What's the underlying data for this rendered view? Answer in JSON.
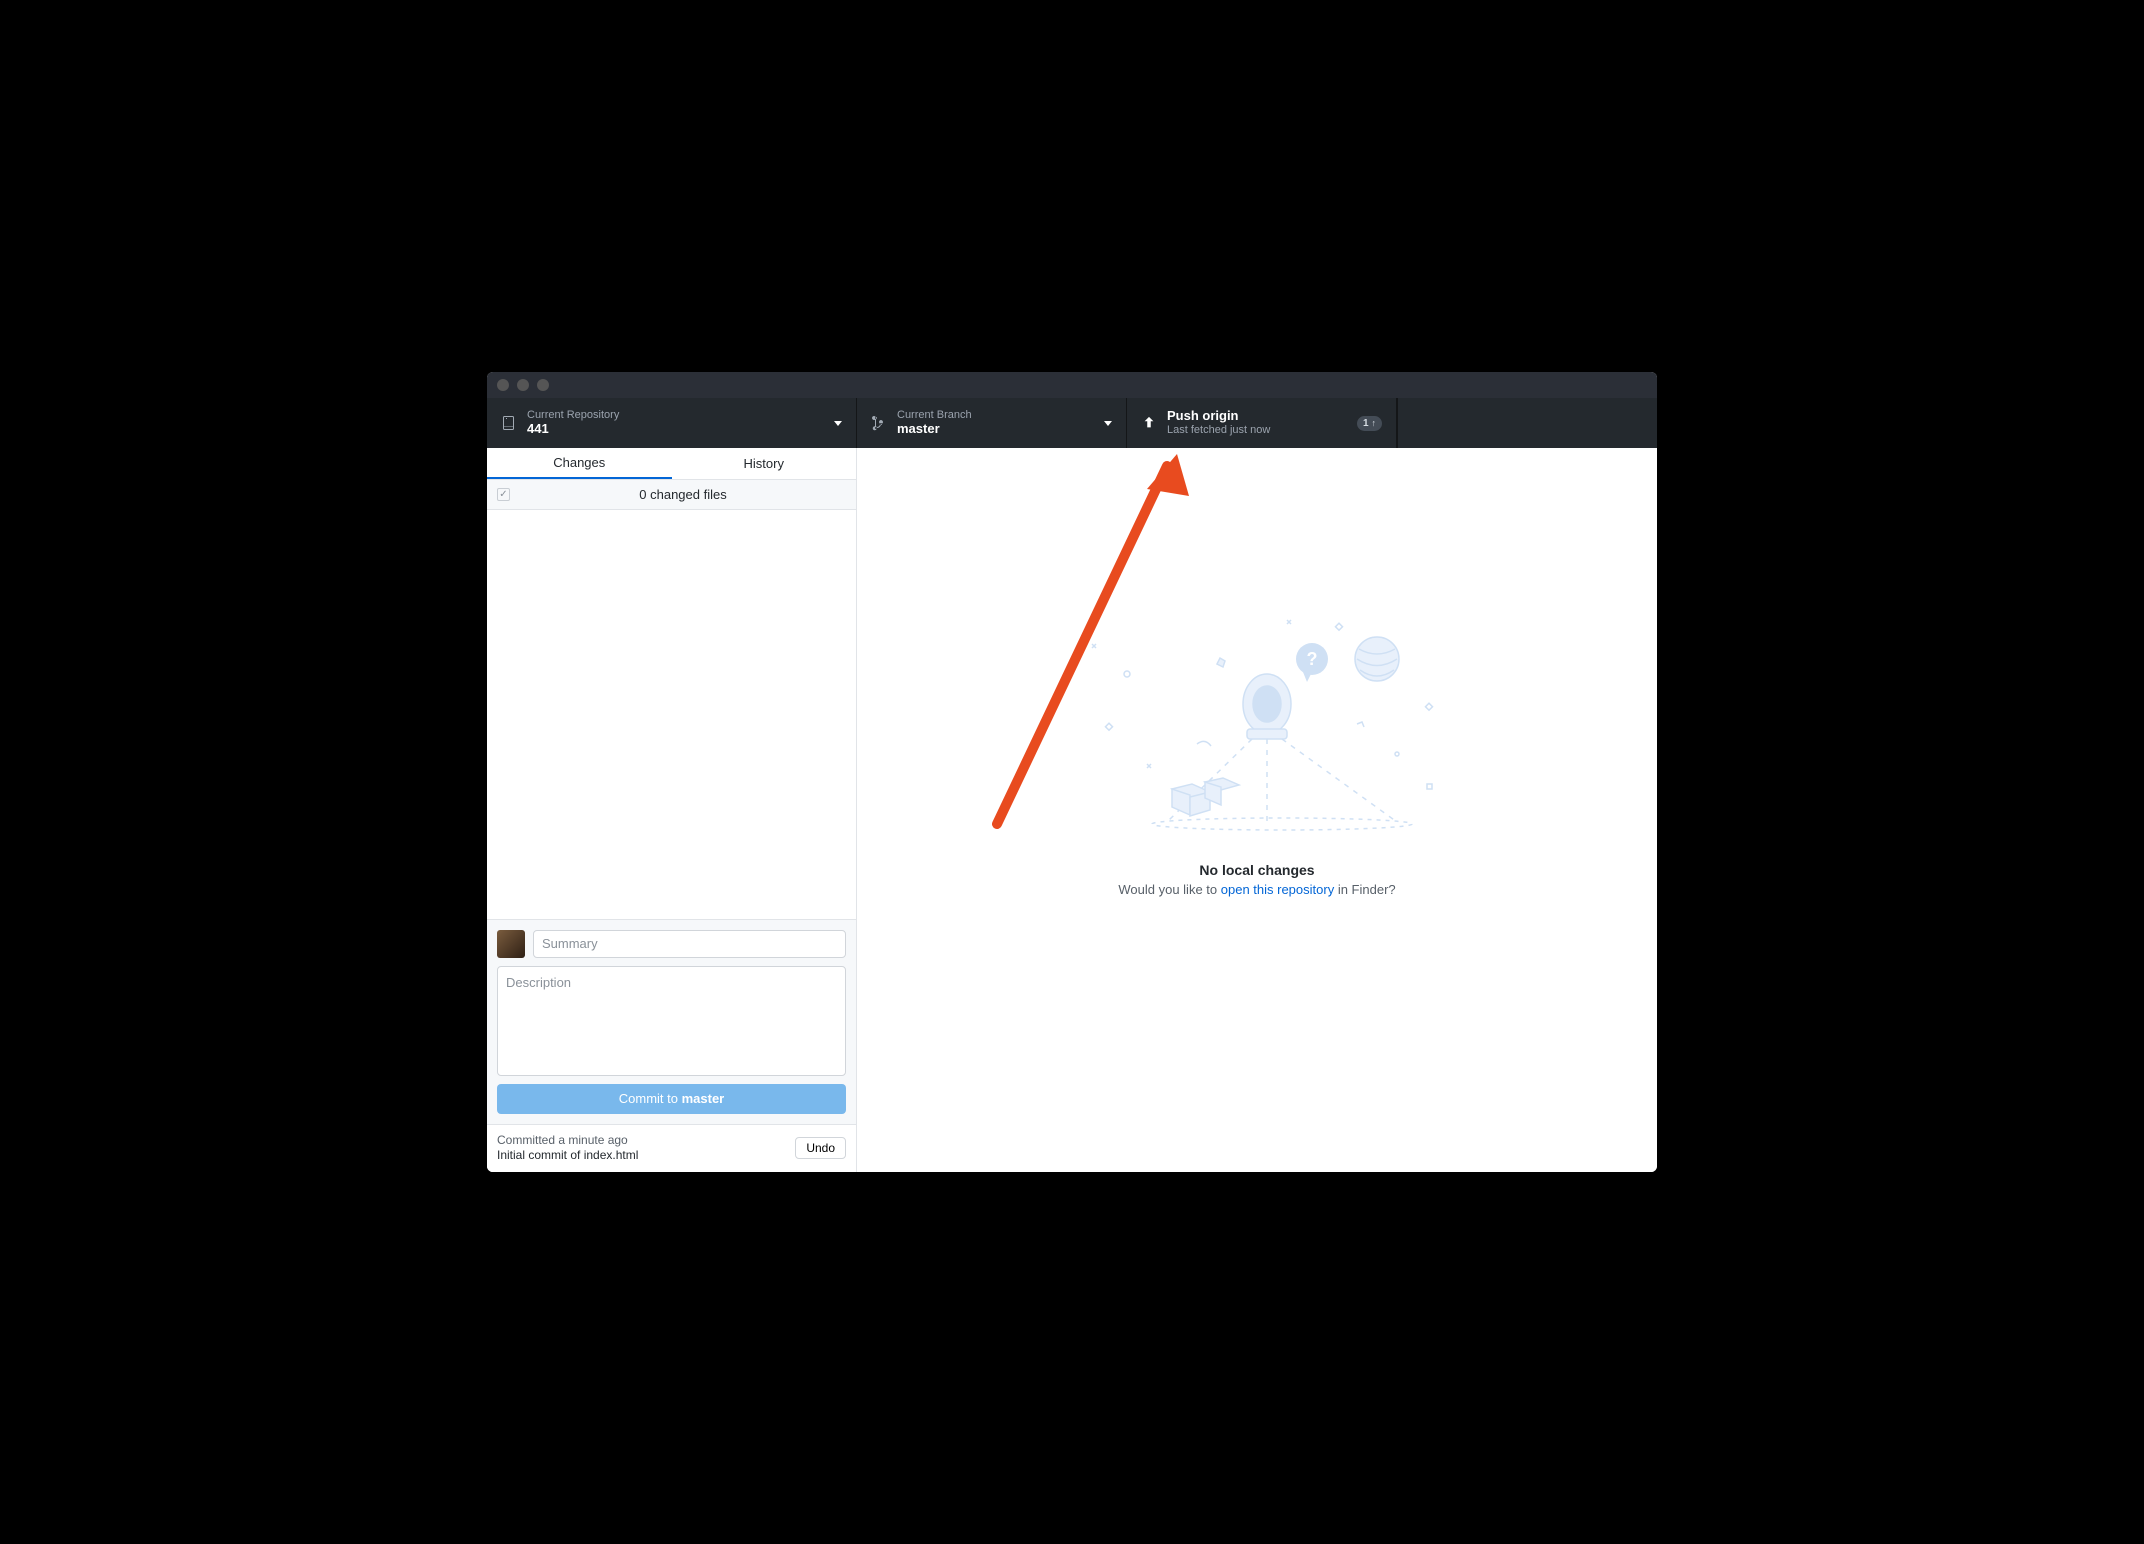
{
  "toolbar": {
    "repo": {
      "label": "Current Repository",
      "value": "441"
    },
    "branch": {
      "label": "Current Branch",
      "value": "master"
    },
    "push": {
      "title": "Push origin",
      "sub": "Last fetched just now",
      "badge_count": "1"
    }
  },
  "sidebar": {
    "tabs": {
      "changes": "Changes",
      "history": "History"
    },
    "changes_header": "0 changed files"
  },
  "commit": {
    "summary_placeholder": "Summary",
    "description_placeholder": "Description",
    "button_prefix": "Commit to ",
    "button_branch": "master"
  },
  "last_commit": {
    "time": "Committed a minute ago",
    "message": "Initial commit of index.html",
    "undo": "Undo"
  },
  "empty": {
    "title": "No local changes",
    "sub_prefix": "Would you like to ",
    "sub_link": "open this repository",
    "sub_suffix": " in Finder?"
  },
  "colors": {
    "annotation": "#e84b1f"
  }
}
